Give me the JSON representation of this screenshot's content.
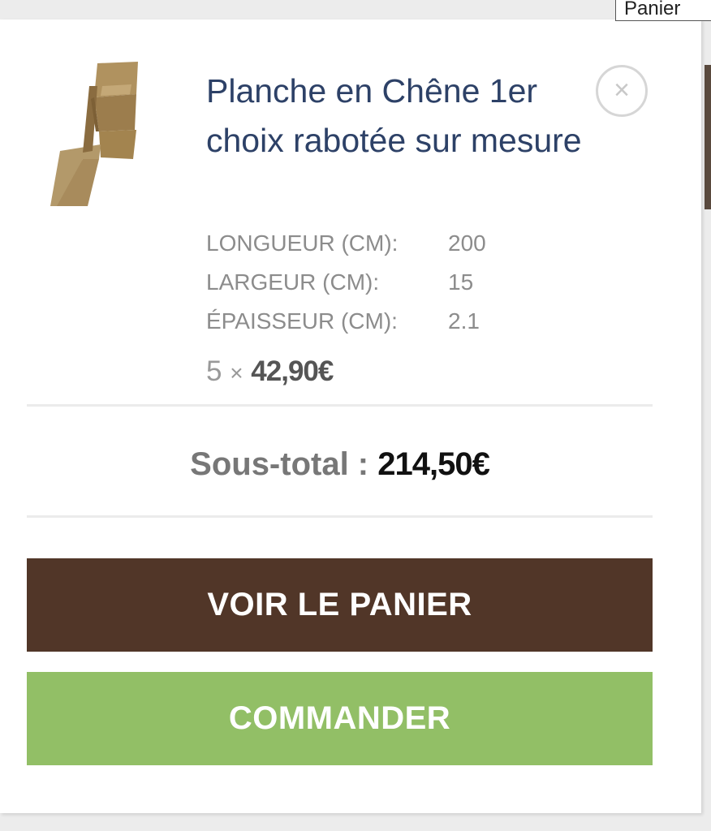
{
  "tooltip": {
    "text": "Panier"
  },
  "cart": {
    "item": {
      "title": "Planche en Chêne 1er choix rabotée sur mesure",
      "remove_symbol": "×",
      "image_icon": "oak-plank-image",
      "variations": [
        {
          "key": "LONGUEUR (CM):",
          "value": "200"
        },
        {
          "key": "LARGEUR (CM):",
          "value": "15"
        },
        {
          "key": "ÉPAISSEUR (CM):",
          "value": "2.1"
        }
      ],
      "quantity": "5",
      "times": "×",
      "unit_price": "42,90€"
    },
    "subtotal": {
      "label": "Sous-total :",
      "amount": "214,50€"
    },
    "view_cart_label": "VOIR LE PANIER",
    "checkout_label": "COMMANDER"
  },
  "colors": {
    "title": "#2d4167",
    "view_cart_bg": "#513628",
    "checkout_bg": "#92bf66"
  }
}
